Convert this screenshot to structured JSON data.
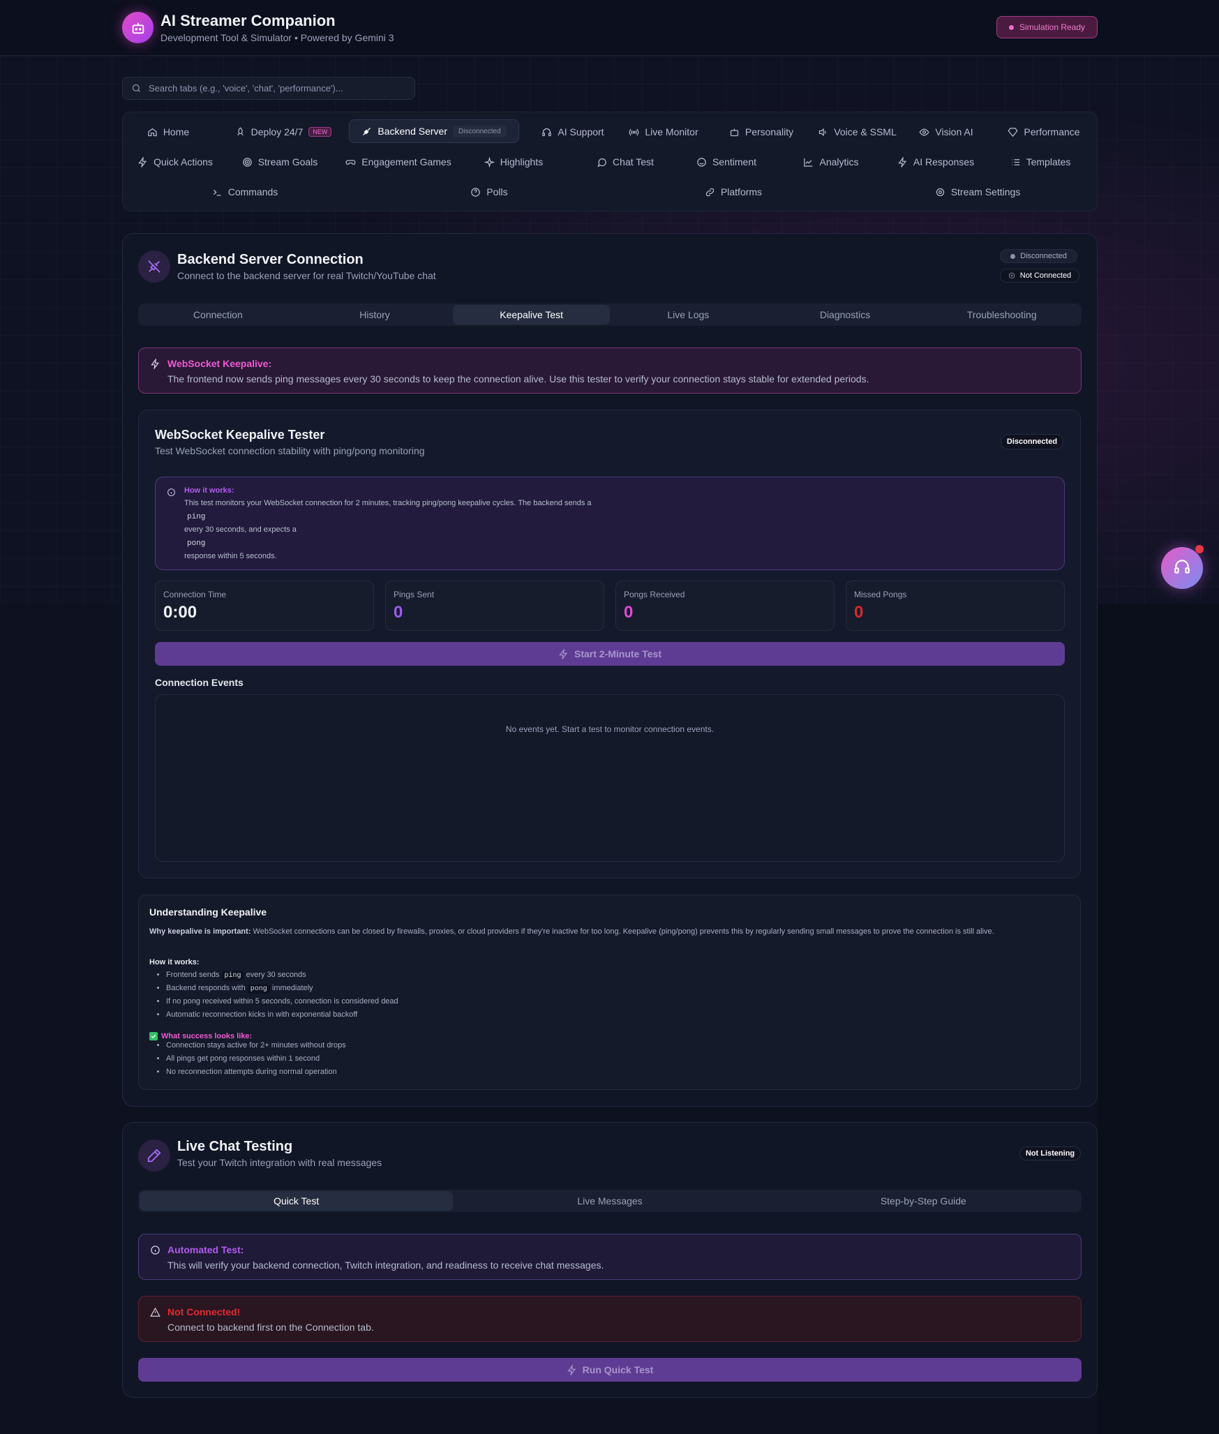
{
  "app": {
    "title": "AI Streamer Companion",
    "subtitle": "Development Tool & Simulator • Powered by Gemini 3",
    "status_badge": "Simulation Ready"
  },
  "search": {
    "placeholder": "Search tabs (e.g., 'voice', 'chat', 'performance')..."
  },
  "nav": {
    "row1": [
      {
        "label": "Home",
        "icon": "home-icon"
      },
      {
        "label": "Deploy 24/7",
        "icon": "rocket-icon",
        "tag": "NEW"
      },
      {
        "label": "Backend Server",
        "icon": "plug-icon",
        "tag": "Disconnected",
        "active": true
      },
      {
        "label": "AI Support",
        "icon": "headphones-icon"
      },
      {
        "label": "Live Monitor",
        "icon": "radio-icon"
      },
      {
        "label": "Personality",
        "icon": "bot-icon"
      },
      {
        "label": "Voice & SSML",
        "icon": "speaker-icon"
      },
      {
        "label": "Vision AI",
        "icon": "eye-icon"
      },
      {
        "label": "Performance",
        "icon": "gem-icon"
      }
    ],
    "row2": [
      {
        "label": "Quick Actions",
        "icon": "zap-icon"
      },
      {
        "label": "Stream Goals",
        "icon": "target-icon"
      },
      {
        "label": "Engagement Games",
        "icon": "gamepad-icon"
      },
      {
        "label": "Highlights",
        "icon": "sparkle-icon"
      },
      {
        "label": "Chat Test",
        "icon": "chat-icon"
      },
      {
        "label": "Sentiment",
        "icon": "smile-icon"
      },
      {
        "label": "Analytics",
        "icon": "chart-icon"
      },
      {
        "label": "AI Responses",
        "icon": "zap-icon"
      },
      {
        "label": "Templates",
        "icon": "list-icon"
      }
    ],
    "row3": [
      {
        "label": "Commands",
        "icon": "terminal-icon"
      },
      {
        "label": "Polls",
        "icon": "help-circle-icon"
      },
      {
        "label": "Platforms",
        "icon": "link-icon"
      },
      {
        "label": "Stream Settings",
        "icon": "settings-icon"
      }
    ]
  },
  "backend_card": {
    "title": "Backend Server Connection",
    "subtitle": "Connect to the backend server for real Twitch/YouTube chat",
    "status1": "Disconnected",
    "status2": "Not Connected",
    "tabs": [
      "Connection",
      "History",
      "Keepalive Test",
      "Live Logs",
      "Diagnostics",
      "Troubleshooting"
    ],
    "active_tab": "Keepalive Test",
    "alert": {
      "title": "WebSocket Keepalive:",
      "text": "The frontend now sends ping messages every 30 seconds to keep the connection alive. Use this tester to verify your connection stays stable for extended periods."
    },
    "tester": {
      "title": "WebSocket Keepalive Tester",
      "subtitle": "Test WebSocket connection stability with ping/pong monitoring",
      "status": "Disconnected",
      "how": {
        "title": "How it works:",
        "line1": "This test monitors your WebSocket connection for 2 minutes, tracking ping/pong keepalive cycles. The backend sends a",
        "code1": "ping",
        "line2": "every 30 seconds, and expects a",
        "code2": "pong",
        "line3": "response within 5 seconds."
      },
      "stats": [
        {
          "label": "Connection Time",
          "value": "0:00",
          "color": "#f2f3f8"
        },
        {
          "label": "Pings Sent",
          "value": "0",
          "color": "#9a5cf0"
        },
        {
          "label": "Pongs Received",
          "value": "0",
          "color": "#e04ad2"
        },
        {
          "label": "Missed Pongs",
          "value": "0",
          "color": "#d42a32"
        }
      ],
      "start_button": "Start 2-Minute Test",
      "events_title": "Connection Events",
      "events_empty": "No events yet. Start a test to monitor connection events."
    },
    "understanding": {
      "title": "Understanding Keepalive",
      "why_label": "Why keepalive is important:",
      "why_text": "WebSocket connections can be closed by firewalls, proxies, or cloud providers if they're inactive for too long. Keepalive (ping/pong) prevents this by regularly sending small messages to prove the connection is still alive.",
      "how_title": "How it works:",
      "how_items": [
        {
          "pre": "Frontend sends",
          "code": "ping",
          "post": "every 30 seconds"
        },
        {
          "pre": "Backend responds with",
          "code": "pong",
          "post": "immediately"
        },
        {
          "pre": "If no pong received within 5 seconds, connection is considered dead",
          "code": "",
          "post": ""
        },
        {
          "pre": "Automatic reconnection kicks in with exponential backoff",
          "code": "",
          "post": ""
        }
      ],
      "success_title": "What success looks like:",
      "success_items": [
        "Connection stays active for 2+ minutes without drops",
        "All pings get pong responses within 1 second",
        "No reconnection attempts during normal operation"
      ]
    }
  },
  "chat_card": {
    "title": "Live Chat Testing",
    "subtitle": "Test your Twitch integration with real messages",
    "status": "Not Listening",
    "tabs": [
      "Quick Test",
      "Live Messages",
      "Step-by-Step Guide"
    ],
    "active_tab": "Quick Test",
    "info": {
      "title": "Automated Test:",
      "text": "This will verify your backend connection, Twitch integration, and readiness to receive chat messages."
    },
    "error": {
      "title": "Not Connected!",
      "text": "Connect to backend first on the Connection tab."
    },
    "run_button": "Run Quick Test"
  },
  "colors": {
    "accent_pink": "#e04ad2",
    "accent_purple": "#9a5cf0",
    "error_red": "#d42a32"
  }
}
